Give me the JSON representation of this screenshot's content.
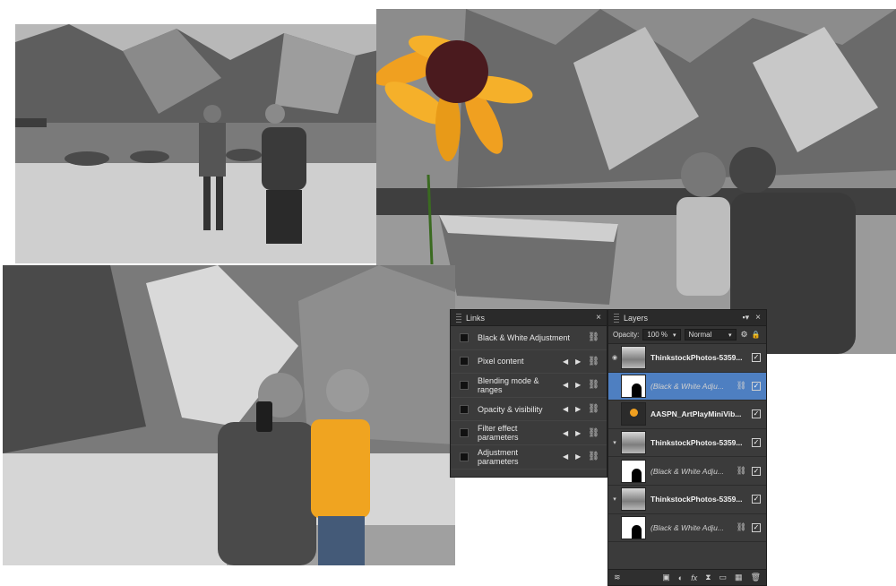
{
  "links_panel": {
    "title": "Links",
    "close_glyph": "×",
    "rows": [
      {
        "label": "Black & White Adjustment",
        "arrows": false
      },
      {
        "label": "Pixel content",
        "arrows": true
      },
      {
        "label": "Blending mode & ranges",
        "arrows": true
      },
      {
        "label": "Opacity & visibility",
        "arrows": true
      },
      {
        "label": "Filter effect parameters",
        "arrows": true
      },
      {
        "label": "Adjustment parameters",
        "arrows": true
      }
    ]
  },
  "layers_panel": {
    "title": "Layers",
    "opacity_label": "Opacity:",
    "opacity_value": "100 %",
    "blend_mode": "Normal",
    "layers": [
      {
        "name": "ThinkstockPhotos-5359...",
        "style": "bold",
        "expander": "▾",
        "thumb": "photo",
        "selected": false,
        "linked": false
      },
      {
        "name": "(Black & White Adju...",
        "style": "italic",
        "expander": "",
        "thumb": "mask",
        "selected": true,
        "linked": true
      },
      {
        "name": "AASPN_ArtPlayMiniVib...",
        "style": "bold",
        "expander": "",
        "thumb": "flower",
        "selected": false,
        "linked": false
      },
      {
        "name": "ThinkstockPhotos-5359...",
        "style": "bold",
        "expander": "▾",
        "thumb": "photo",
        "selected": false,
        "linked": false
      },
      {
        "name": "(Black & White Adju...",
        "style": "italic",
        "expander": "",
        "thumb": "mask",
        "selected": false,
        "linked": true
      },
      {
        "name": "ThinkstockPhotos-5359...",
        "style": "bold",
        "expander": "▾",
        "thumb": "photo",
        "selected": false,
        "linked": false
      },
      {
        "name": "(Black & White Adju...",
        "style": "italic",
        "expander": "",
        "thumb": "mask",
        "selected": false,
        "linked": true
      }
    ],
    "footer_icons": [
      "layers-stack-icon",
      "mask-icon",
      "adjustment-icon",
      "fx-icon",
      "hourglass-icon",
      "folder-icon",
      "group-icon",
      "trash-icon"
    ]
  },
  "colors": {
    "panel_bg": "#3b3b3b",
    "selection": "#4e7fc1",
    "accent_yellow": "#f0a020"
  }
}
